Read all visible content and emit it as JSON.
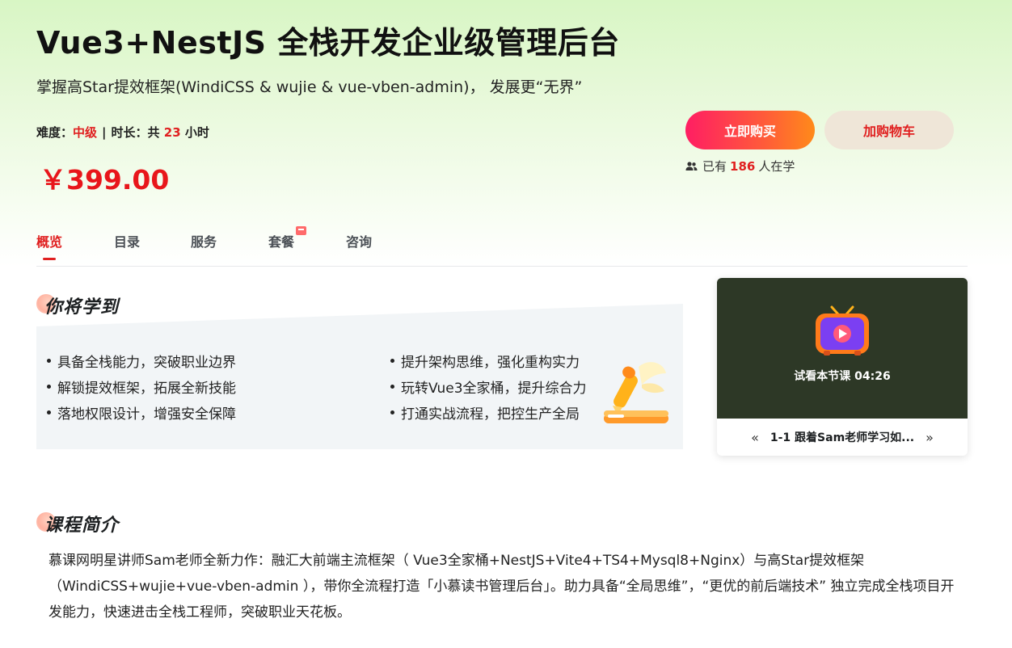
{
  "course": {
    "title": "Vue3+NestJS 全栈开发企业级管理后台",
    "subtitle": "掌握高Star提效框架(WindiCSS & wujie & vue-vben-admin)， 发展更“无界”",
    "difficulty_label": "难度：",
    "difficulty_value": "中级",
    "separator": "|",
    "duration_label": "时长：共",
    "duration_value": "23",
    "duration_unit": "小时",
    "price": "￥399.00"
  },
  "actions": {
    "buy_label": "立即购买",
    "cart_label": "加购物车",
    "learners_prefix": "已有",
    "learners_count": "186",
    "learners_suffix": "人在学"
  },
  "tabs": [
    {
      "label": "概览",
      "active": true
    },
    {
      "label": "目录",
      "active": false
    },
    {
      "label": "服务",
      "active": false
    },
    {
      "label": "套餐",
      "active": false,
      "badge": true
    },
    {
      "label": "咨询",
      "active": false
    }
  ],
  "learn": {
    "heading": "你将学到",
    "items_left": [
      "具备全栈能力，突破职业边界",
      "解锁提效框架，拓展全新技能",
      "落地权限设计，增强安全保障"
    ],
    "items_right": [
      "提升架构思维，强化重构实力",
      "玩转Vue3全家桶，提升综合力",
      "打通实战流程，把控生产全局"
    ]
  },
  "video": {
    "trial_label": "试看本节课 04:26",
    "lesson_title": "1-1 跟着Sam老师学习如...",
    "prev_glyph": "«",
    "next_glyph": "»"
  },
  "intro": {
    "heading": "课程简介",
    "body": "慕课网明星讲师Sam老师全新力作：融汇大前端主流框架（ Vue3全家桶+NestJS+Vite4+TS4+Mysql8+Nginx）与高Star提效框架（WindiCSS+wujie+vue-vben-admin ），带你全流程打造「小慕读书管理后台」。助力具备“全局思维”，“更优的前后端技术” 独立完成全栈项目开发能力，快速进击全栈工程师，突破职业天花板。"
  },
  "colors": {
    "accent_red": "#e02020",
    "buy_gradient_start": "#ff1e63",
    "buy_gradient_end": "#ff8a1a",
    "cart_bg": "#efe6d8",
    "hero_green": "#d8f6c4"
  }
}
